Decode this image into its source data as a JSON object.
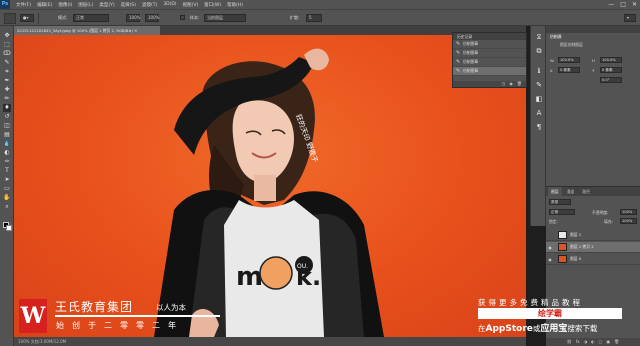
{
  "app": {
    "logo": "Ps",
    "menu": [
      "文件(F)",
      "编辑(E)",
      "图像(I)",
      "图层(L)",
      "类型(Y)",
      "选择(S)",
      "滤镜(T)",
      "3D(D)",
      "视图(V)",
      "窗口(W)",
      "帮助(H)"
    ],
    "window_controls": [
      "—",
      "□",
      "✕"
    ]
  },
  "options": {
    "mode_label": "模式:",
    "mode_value": "正常",
    "opacity_value": "100%",
    "flow_value": "100%",
    "sample_label": "样本:",
    "sample_value": "当前图层",
    "diffuse_label": "扩散:",
    "diffuse_value": "5"
  },
  "document": {
    "tab": "20151121202843_5Ayt.jpeg @ 100% (图层 1 拷贝 2, RGB/8#) ✕",
    "status": "100%    文档:3.00M/12.0M"
  },
  "toolbar": {
    "icons": [
      "move-icon",
      "marquee-icon",
      "lasso-icon",
      "quick-select-icon",
      "crop-icon",
      "eyedropper-icon",
      "healing-brush-icon",
      "brush-icon",
      "clone-stamp-icon",
      "history-brush-icon",
      "eraser-icon",
      "gradient-icon",
      "blur-icon",
      "dodge-icon",
      "pen-icon",
      "type-icon",
      "path-select-icon",
      "shape-icon",
      "hand-icon",
      "zoom-icon"
    ],
    "glyphs": [
      "✥",
      "⬚",
      "ↀ",
      "✎",
      "⌗",
      "✒",
      "✚",
      "✏",
      "♦",
      "↺",
      "◫",
      "▤",
      "💧",
      "◐",
      "✑",
      "T",
      "➤",
      "▭",
      "✋",
      "⌕"
    ]
  },
  "history": {
    "title": "历史记录",
    "items": [
      "仿制图章",
      "仿制图章",
      "仿制图章",
      "仿制图章"
    ]
  },
  "properties": {
    "title": "仿制源",
    "doc_label": "图层仿制图层",
    "w_label": "W",
    "h_label": "H",
    "w_value": "100.0%",
    "h_value": "100.0%",
    "x_label": "X",
    "y_label": "Y",
    "x_value": "0 像素",
    "y_value": "0 像素",
    "angle_value": "0.0°"
  },
  "layers": {
    "tabs": [
      "图层",
      "通道",
      "路径"
    ],
    "filter_label": "类型",
    "blend_mode": "正常",
    "opacity_label": "不透明度:",
    "opacity_value": "100%",
    "lock_label": "锁定:",
    "fill_label": "填充:",
    "fill_value": "100%",
    "items": [
      {
        "name": "图层 1",
        "selected": false
      },
      {
        "name": "图层 1 拷贝 2",
        "selected": true
      },
      {
        "name": "图层 0",
        "selected": false
      }
    ],
    "footer_icons": [
      "⛓",
      "fx",
      "◑",
      "◐",
      "▢",
      "▣",
      "🗑"
    ]
  },
  "photo": {
    "shirt_text_1": "m",
    "shirt_text_2": "k.",
    "shirt_badge": "OU.",
    "hand_text": "狂的天印 野鹿子"
  },
  "watermark": {
    "logo_letter": "W",
    "title": "王氏教育集团",
    "slogan": "以人为本",
    "sub": "始创于二零零二年",
    "ad_top": "获得更多免费精品教程",
    "ad_box": "绘学霸",
    "ad_bottom_pre": "在",
    "ad_bottom_store": "AppStore",
    "ad_bottom_or": "或",
    "ad_bottom_app": "应用宝",
    "ad_bottom_post": "搜索下载"
  },
  "colors": {
    "accent_red": "#d6221e",
    "backdrop_orange": "#e8501b"
  }
}
